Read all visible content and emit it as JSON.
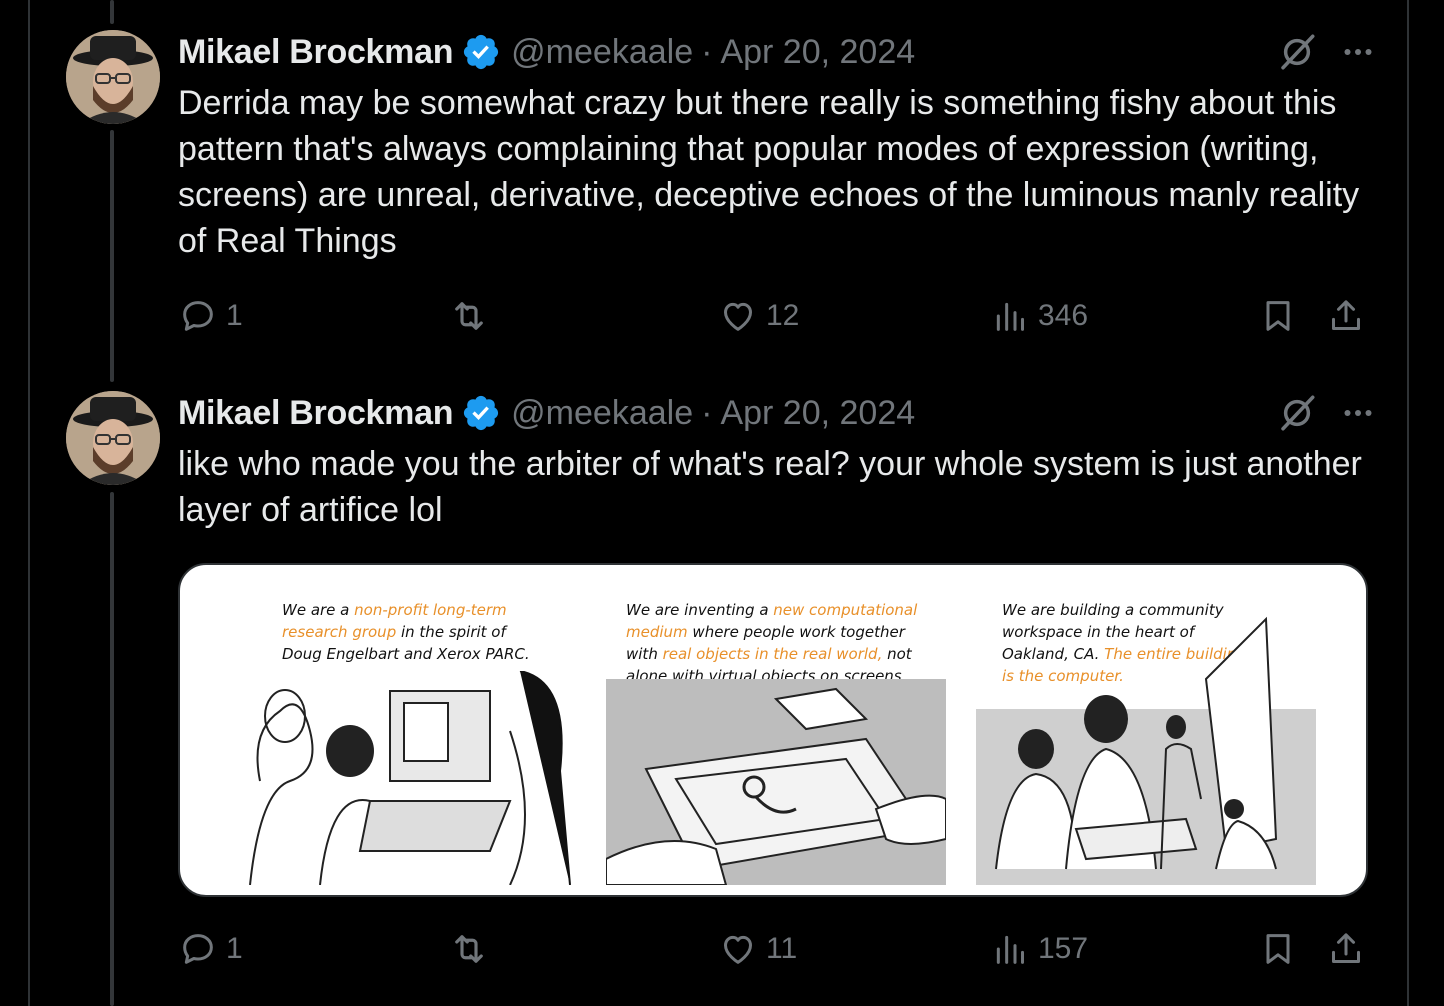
{
  "tweets": [
    {
      "author": "Mikael Brockman",
      "handle": "@meekaale",
      "separator": "·",
      "date": "Apr 20, 2024",
      "text": "Derrida may be somewhat crazy but there really is something fishy about this pattern that's always complaining that popular modes of expression (writing, screens) are unreal, derivative, deceptive echoes of the luminous manly reality of Real Things",
      "replies": "1",
      "reposts": "",
      "likes": "12",
      "views": "346"
    },
    {
      "author": "Mikael Brockman",
      "handle": "@meekaale",
      "separator": "·",
      "date": "Apr 20, 2024",
      "text": "like who made you the arbiter of what's real? your whole system is just another layer of artifice lol",
      "replies": "1",
      "reposts": "",
      "likes": "11",
      "views": "157",
      "media": {
        "panels": [
          {
            "parts": [
              "We are a ",
              "non-profit long-term research group",
              " in the spirit of Doug Engelbart and Xerox PARC."
            ]
          },
          {
            "parts": [
              "We are inventing a ",
              "new computational medium",
              " where people work together with ",
              "real objects in the real world,",
              " not alone with virtual objects on screens."
            ]
          },
          {
            "parts": [
              "We are building a community workspace in the heart of Oakland, CA. ",
              "The entire building is the computer."
            ]
          }
        ]
      }
    }
  ],
  "icons": {
    "verified": "verified-badge-icon",
    "grok": "grok-icon",
    "more": "more-icon",
    "reply": "reply-icon",
    "repost": "repost-icon",
    "like": "heart-icon",
    "views": "views-icon",
    "bookmark": "bookmark-icon",
    "share": "share-icon"
  },
  "colors": {
    "background": "#000000",
    "text": "#e7e9ea",
    "secondary": "#71767b",
    "verified": "#1d9bf0",
    "highlight": "#e8902a"
  }
}
